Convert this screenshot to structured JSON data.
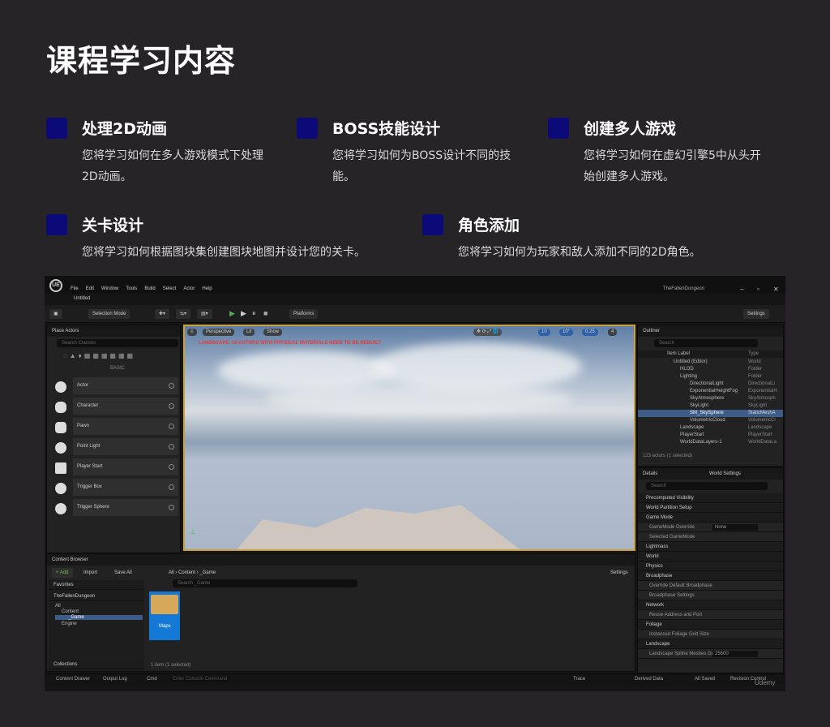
{
  "page": {
    "title": "课程学习内容"
  },
  "features": [
    {
      "title": "处理2D动画",
      "desc_lines": [
        "您将学习如何在多人游戏模式下处理",
        "2D动画。"
      ]
    },
    {
      "title": "BOSS技能设计",
      "desc_lines": [
        "您将学习如何为BOSS设计不同的技",
        "能。"
      ]
    },
    {
      "title": "创建多人游戏",
      "desc_lines": [
        "您将学习如何在虚幻引擎5中从头开",
        "始创建多人游戏。"
      ]
    },
    {
      "title": "关卡设计",
      "desc_lines": [
        "您将学习如何根据图块集创建图块地图并设计您的关卡。"
      ]
    },
    {
      "title": "角色添加",
      "desc_lines": [
        "您将学习如何为玩家和敌人添加不同的2D角色。"
      ]
    }
  ],
  "editor": {
    "logo": "UE",
    "menu": [
      "File",
      "Edit",
      "Window",
      "Tools",
      "Build",
      "Select",
      "Actor",
      "Help"
    ],
    "level_tab": "Untitled",
    "project_name": "TheFallenDungeon",
    "toolbar": {
      "selection_mode": "Selection Mode",
      "platforms": "Platforms",
      "settings": "Settings"
    },
    "place_actors": {
      "tab": "Place Actors",
      "search_placeholder": "Search Classes",
      "category": "BASIC",
      "items": [
        "Actor",
        "Character",
        "Pawn",
        "Point Light",
        "Player Start",
        "Trigger Box",
        "Trigger Sphere"
      ]
    },
    "viewport": {
      "perspective": "Perspective",
      "lit": "Lit",
      "show": "Show",
      "warning": "LANDSCAPE: 16 ACTORS WITH PHYSICAL MATERIALS NEED TO BE REBUILT",
      "right_values": [
        "10",
        "10°",
        "0.25",
        "4"
      ]
    },
    "outliner": {
      "tab": "Outliner",
      "search_placeholder": "Search",
      "col_item": "Item Label",
      "col_type": "Type",
      "rows": [
        {
          "name": "Untitled (Editor)",
          "type": "World"
        },
        {
          "name": "HLOD",
          "type": "Folder"
        },
        {
          "name": "Lighting",
          "type": "Folder"
        },
        {
          "name": "DirectionalLight",
          "type": "DirectionalLi"
        },
        {
          "name": "ExponentialHeightFog",
          "type": "ExponentialH"
        },
        {
          "name": "SkyAtmosphere",
          "type": "SkyAtmosph"
        },
        {
          "name": "SkyLight",
          "type": "SkyLight"
        },
        {
          "name": "SM_SkySphere",
          "type": "StaticMeshA"
        },
        {
          "name": "VolumetricCloud",
          "type": "VolumetricCl"
        },
        {
          "name": "Landscape",
          "type": "Landscape"
        },
        {
          "name": "PlayerStart",
          "type": "PlayerStart"
        },
        {
          "name": "WorldDataLayers-1",
          "type": "WorldDataLa"
        }
      ],
      "count": "123 actors (1 selected)"
    },
    "details": {
      "tab": "Details",
      "tab2": "World Settings",
      "search_placeholder": "Search",
      "sections": [
        {
          "label": "Precomputed Visibility",
          "sub": false
        },
        {
          "label": "World Partition Setup",
          "sub": false
        },
        {
          "label": "Game Mode",
          "sub": false
        },
        {
          "label": "GameMode Override",
          "sub": true,
          "value": "None"
        },
        {
          "label": "Selected GameMode",
          "sub": true
        },
        {
          "label": "Lightmass",
          "sub": false
        },
        {
          "label": "World",
          "sub": false
        },
        {
          "label": "Physics",
          "sub": false
        },
        {
          "label": "Broadphase",
          "sub": false
        },
        {
          "label": "Override Default Broadphase",
          "sub": true
        },
        {
          "label": "Broadphase Settings",
          "sub": true
        },
        {
          "label": "Network",
          "sub": false
        },
        {
          "label": "Reuse Address and Port",
          "sub": true
        },
        {
          "label": "Foliage",
          "sub": false
        },
        {
          "label": "Instanced Foliage Grid Size",
          "sub": true
        },
        {
          "label": "Landscape",
          "sub": false
        },
        {
          "label": "Landscape Spline Meshes Gr",
          "sub": true,
          "value": "25600"
        }
      ]
    },
    "content_browser": {
      "tab": "Content Browser",
      "add": "+ Add",
      "import": "Import",
      "save_all": "Save All",
      "path": [
        "All",
        "Content",
        "_Game"
      ],
      "settings": "Settings",
      "favorites": "Favorites",
      "project": "TheFallenDungeon",
      "tree": [
        "All",
        "Content",
        "_Game",
        "Engine"
      ],
      "search_placeholder": "Search _Game",
      "folder_label": "Maps",
      "items_text": "1 item (1 selected)",
      "collections": "Collections"
    },
    "statusbar": {
      "content_drawer": "Content Drawer",
      "output_log": "Output Log",
      "cmd": "Cmd",
      "console_placeholder": "Enter Console Command",
      "trace": "Trace",
      "derived_data": "Derived Data",
      "all_saved": "All Saved",
      "revision_control": "Revision Control",
      "watermark": "Udemy"
    }
  }
}
